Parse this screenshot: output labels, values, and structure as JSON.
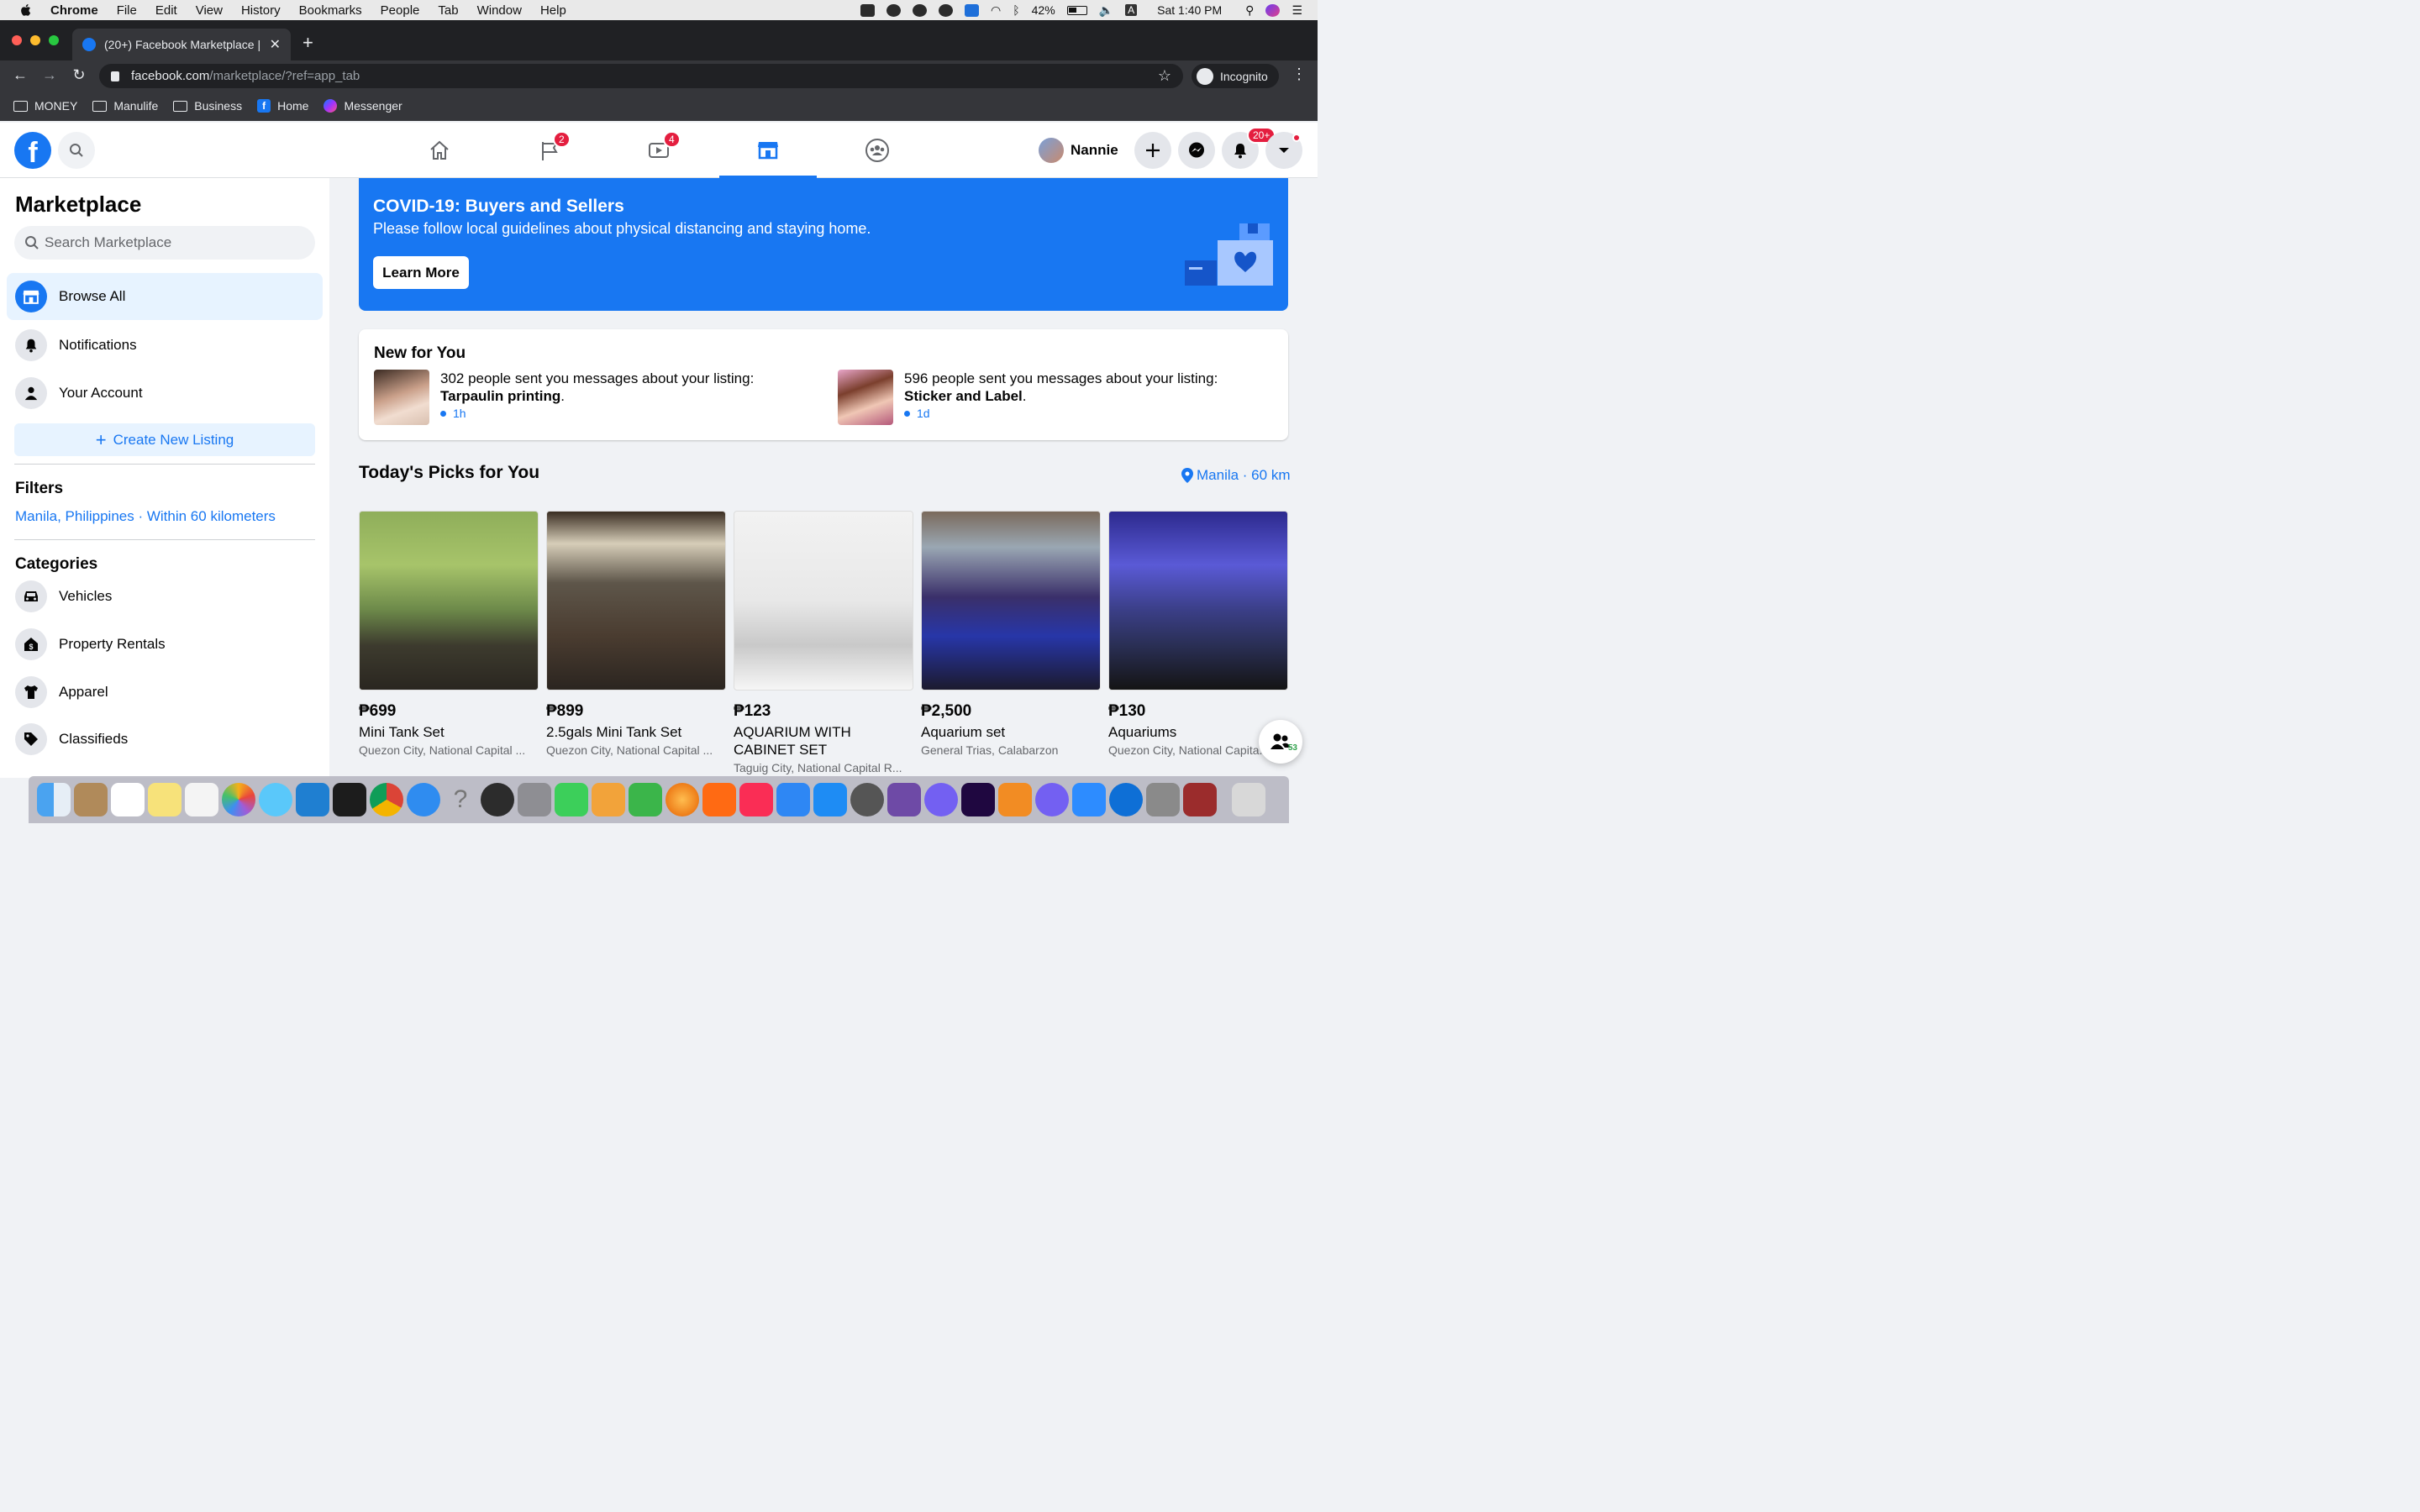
{
  "menubar": {
    "app": "Chrome",
    "items": [
      "File",
      "Edit",
      "View",
      "History",
      "Bookmarks",
      "People",
      "Tab",
      "Window",
      "Help"
    ],
    "battery": "42%",
    "clock": "Sat 1:40 PM",
    "input_source": "A"
  },
  "browser": {
    "tab_title": "(20+) Facebook Marketplace |",
    "url_host": "facebook.com",
    "url_path": "/marketplace/?ref=app_tab",
    "incognito_label": "Incognito",
    "bookmarks": [
      "MONEY",
      "Manulife",
      "Business",
      "Home",
      "Messenger"
    ]
  },
  "fb": {
    "logo": "f",
    "badges": {
      "pages": "2",
      "watch": "4",
      "notifications": "20+"
    },
    "profile_name": "Nannie"
  },
  "sidebar": {
    "title": "Marketplace",
    "search_placeholder": "Search Marketplace",
    "items": [
      {
        "label": "Browse All",
        "icon": "shop-icon"
      },
      {
        "label": "Notifications",
        "icon": "bell-icon"
      },
      {
        "label": "Your Account",
        "icon": "person-icon"
      }
    ],
    "create_label": "Create New Listing",
    "filters_heading": "Filters",
    "filter_location": "Manila, Philippines · Within 60 kilometers",
    "categories_heading": "Categories",
    "categories": [
      {
        "label": "Vehicles",
        "icon": "car-icon"
      },
      {
        "label": "Property Rentals",
        "icon": "house-icon"
      },
      {
        "label": "Apparel",
        "icon": "shirt-icon"
      },
      {
        "label": "Classifieds",
        "icon": "tag-icon"
      }
    ]
  },
  "covid": {
    "title": "COVID-19: Buyers and Sellers",
    "body": "Please follow local guidelines about physical distancing and staying home.",
    "button": "Learn More"
  },
  "new_for_you": {
    "heading": "New for You",
    "items": [
      {
        "text": "302 people sent you messages about your listing: ",
        "bold": "Tarpaulin printing",
        "time": "1h"
      },
      {
        "text": "596 people sent you messages about your listing: ",
        "bold": "Sticker and Label",
        "time": "1d"
      }
    ]
  },
  "picks": {
    "heading": "Today's Picks for You",
    "location": "Manila · 60 km",
    "listings": [
      {
        "price": "₱699",
        "name": "Mini Tank Set",
        "location": "Quezon City, National Capital ..."
      },
      {
        "price": "₱899",
        "name": "2.5gals Mini Tank Set",
        "location": "Quezon City, National Capital ..."
      },
      {
        "price": "₱123",
        "name": "AQUARIUM WITH CABINET SET",
        "location": "Taguig City, National Capital R..."
      },
      {
        "price": "₱2,500",
        "name": "Aquarium set",
        "location": "General Trias, Calabarzon"
      },
      {
        "price": "₱130",
        "name": "Aquariums",
        "location": "Quezon City, National Capita..."
      }
    ]
  },
  "floating_contacts_count": "53",
  "colors": {
    "accent": "#1877f2",
    "badge": "#e41e3f",
    "page_bg": "#f0f2f5"
  }
}
